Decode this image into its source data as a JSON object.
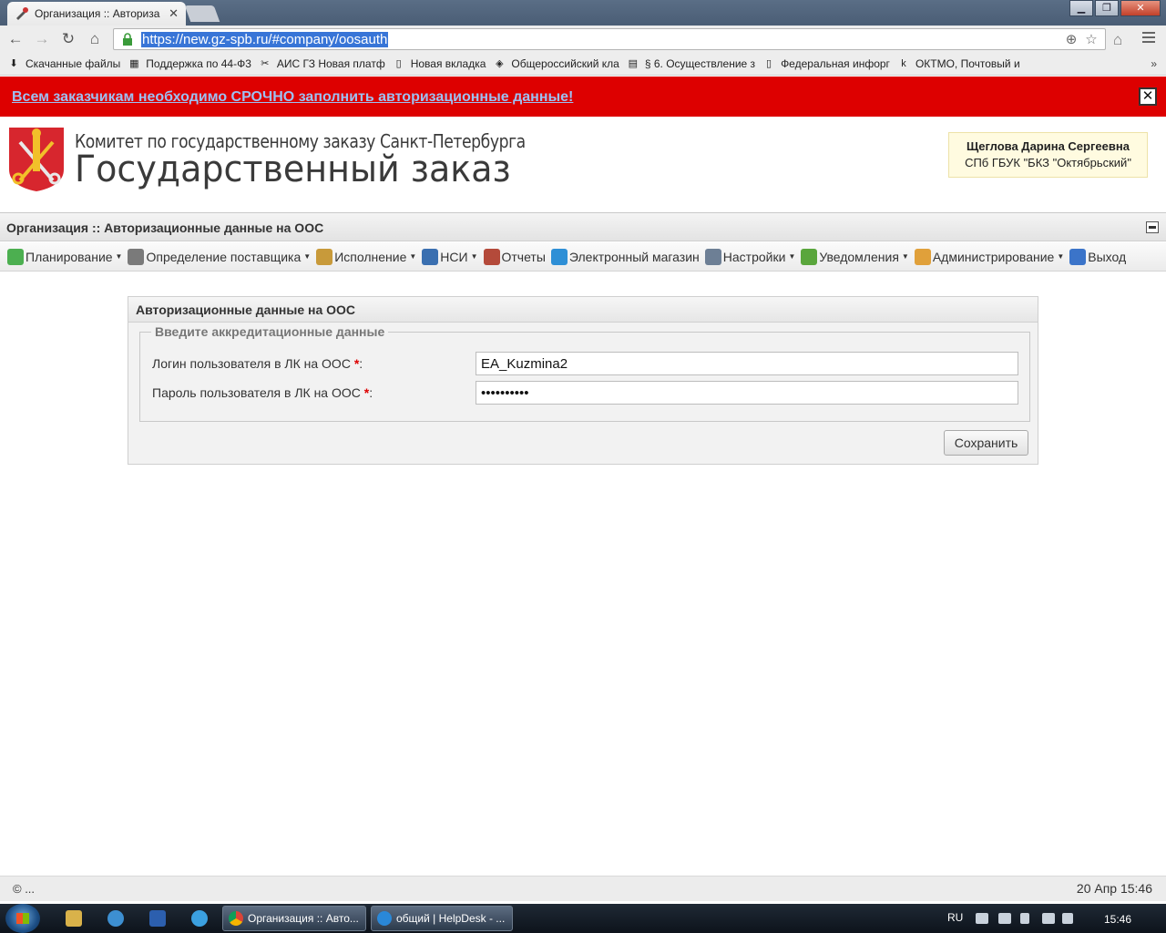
{
  "browser": {
    "tab_title": "Организация :: Авториза",
    "url": "https://new.gz-spb.ru/#company/oosauth",
    "bookmarks": [
      {
        "label": "Скачанные файлы",
        "icon": "download-icon"
      },
      {
        "label": "Поддержка по 44-Ф3",
        "icon": "na-iz-icon"
      },
      {
        "label": "АИС ГЗ Новая платф",
        "icon": "tools-icon"
      },
      {
        "label": "Новая вкладка",
        "icon": "page-icon"
      },
      {
        "label": "Общероссийский кла",
        "icon": "classifier-icon"
      },
      {
        "label": "§ 6. Осуществление з",
        "icon": "doc-icon"
      },
      {
        "label": "Федеральная инфорг",
        "icon": "page-icon"
      },
      {
        "label": "ОКТМО, Почтовый и",
        "icon": "kod-icon"
      }
    ],
    "bookmarks_more": "»"
  },
  "alert": {
    "text": "Всем заказчикам необходимо СРОЧНО заполнить авторизационные данные!",
    "close": "✕"
  },
  "header": {
    "logo_line1": "Комитет по государственному заказу Санкт-Петербурга",
    "logo_line2": "Государственный заказ",
    "user_name": "Щеглова Дарина Сергеевна",
    "user_org": "СПб ГБУК \"БКЗ \"Октябрьский\""
  },
  "page": {
    "title": "Организация :: Авторизационные данные на ООС"
  },
  "menu": [
    {
      "label": "Планирование",
      "dropdown": true,
      "color": "#4caf50"
    },
    {
      "label": "Определение поставщика",
      "dropdown": true,
      "color": "#7a7a7a"
    },
    {
      "label": "Исполнение",
      "dropdown": true,
      "color": "#c89a3a"
    },
    {
      "label": "НСИ",
      "dropdown": true,
      "color": "#3a6fb0"
    },
    {
      "label": "Отчеты",
      "dropdown": false,
      "color": "#b44a3a"
    },
    {
      "label": "Электронный магазин",
      "dropdown": false,
      "color": "#2e8fd6"
    },
    {
      "label": "Настройки",
      "dropdown": true,
      "color": "#6d7f95"
    },
    {
      "label": "Уведомления",
      "dropdown": true,
      "color": "#5aa63c"
    },
    {
      "label": "Администрирование",
      "dropdown": true,
      "color": "#e0a03a"
    },
    {
      "label": "Выход",
      "dropdown": false,
      "color": "#3b74c9"
    }
  ],
  "form": {
    "panel_title": "Авторизационные данные на ООС",
    "legend": "Введите аккредитационные данные",
    "login_label": "Логин пользователя в ЛК на ООС",
    "login_value": "EA_Kuzmina2",
    "password_label": "Пароль пользователя в ЛК на ООС",
    "password_value": "••••••••••",
    "required_mark": "*",
    "colon": ":",
    "save_label": "Сохранить"
  },
  "footer": {
    "copyright": "© ...",
    "datetime": "20 Апр 15:46"
  },
  "taskbar": {
    "tasks": [
      {
        "label": "Организация :: Авто...",
        "icon": "chrome-icon"
      },
      {
        "label": "общий | HelpDesk - ...",
        "icon": "ie-icon"
      }
    ],
    "lang": "RU",
    "clock": "15:46"
  }
}
